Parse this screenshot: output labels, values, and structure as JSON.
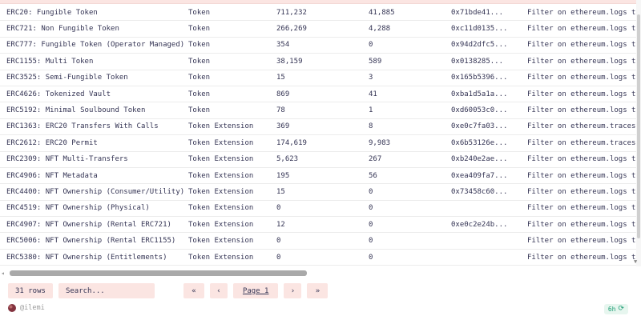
{
  "table": {
    "rows": [
      {
        "standard": "ERC20: Fungible Token",
        "type": "Token",
        "count_a": "711,232",
        "count_b": "41,885",
        "address": "0x71bde41...",
        "filter": "Filter on ethereum.logs t"
      },
      {
        "standard": "ERC721: Non Fungible Token",
        "type": "Token",
        "count_a": "266,269",
        "count_b": "4,288",
        "address": "0xc11d0135...",
        "filter": "Filter on ethereum.logs t"
      },
      {
        "standard": "ERC777: Fungible Token (Operator Managed)",
        "type": "Token",
        "count_a": "354",
        "count_b": "0",
        "address": "0x94d2dfc5...",
        "filter": "Filter on ethereum.logs t"
      },
      {
        "standard": "ERC1155: Multi Token",
        "type": "Token",
        "count_a": "38,159",
        "count_b": "589",
        "address": "0x0138285...",
        "filter": "Filter on ethereum.logs t"
      },
      {
        "standard": "ERC3525: Semi-Fungible Token",
        "type": "Token",
        "count_a": "15",
        "count_b": "3",
        "address": "0x165b5396...",
        "filter": "Filter on ethereum.logs t"
      },
      {
        "standard": "ERC4626: Tokenized Vault",
        "type": "Token",
        "count_a": "869",
        "count_b": "41",
        "address": "0xba1d5a1a...",
        "filter": "Filter on ethereum.logs t"
      },
      {
        "standard": "ERC5192: Minimal Soulbound Token",
        "type": "Token",
        "count_a": "78",
        "count_b": "1",
        "address": "0xd60053c0...",
        "filter": "Filter on ethereum.logs t"
      },
      {
        "standard": "ERC1363: ERC20 Transfers With Calls",
        "type": "Token Extension",
        "count_a": "369",
        "count_b": "8",
        "address": "0xe0c7fa03...",
        "filter": "Filter on ethereum.traces"
      },
      {
        "standard": "ERC2612: ERC20 Permit",
        "type": "Token Extension",
        "count_a": "174,619",
        "count_b": "9,983",
        "address": "0x6b53126e...",
        "filter": "Filter on ethereum.traces"
      },
      {
        "standard": "ERC2309: NFT Multi-Transfers",
        "type": "Token Extension",
        "count_a": "5,623",
        "count_b": "267",
        "address": "0xb240e2ae...",
        "filter": "Filter on ethereum.logs t"
      },
      {
        "standard": "ERC4906: NFT Metadata",
        "type": "Token Extension",
        "count_a": "195",
        "count_b": "56",
        "address": "0xea409fa7...",
        "filter": "Filter on ethereum.logs t"
      },
      {
        "standard": "ERC4400: NFT Ownership (Consumer/Utility)",
        "type": "Token Extension",
        "count_a": "15",
        "count_b": "0",
        "address": "0x73458c60...",
        "filter": "Filter on ethereum.logs t"
      },
      {
        "standard": "ERC4519: NFT Ownership (Physical)",
        "type": "Token Extension",
        "count_a": "0",
        "count_b": "0",
        "address": "",
        "filter": "Filter on ethereum.logs t"
      },
      {
        "standard": "ERC4907: NFT Ownership (Rental ERC721)",
        "type": "Token Extension",
        "count_a": "12",
        "count_b": "0",
        "address": "0xe0c2e24b...",
        "filter": "Filter on ethereum.logs t"
      },
      {
        "standard": "ERC5006: NFT Ownership (Rental ERC1155)",
        "type": "Token Extension",
        "count_a": "0",
        "count_b": "0",
        "address": "",
        "filter": "Filter on ethereum.logs t"
      },
      {
        "standard": "ERC5380: NFT Ownership (Entitlements)",
        "type": "Token Extension",
        "count_a": "0",
        "count_b": "0",
        "address": "",
        "filter": "Filter on ethereum.logs t"
      }
    ]
  },
  "footer": {
    "row_count": "31 rows",
    "search_placeholder": "Search...",
    "pagination": {
      "first": "«",
      "prev": "‹",
      "page_label": "Page 1",
      "next": "›",
      "last": "»"
    }
  },
  "attribution": {
    "handle": "@ilemi"
  },
  "refresh": {
    "age": "6h",
    "icon": "⟳"
  },
  "colors": {
    "accent_pink": "#fbe5e2",
    "text": "#343454",
    "refresh_green": "#1d9d74",
    "refresh_bg": "#e7f6ef"
  }
}
